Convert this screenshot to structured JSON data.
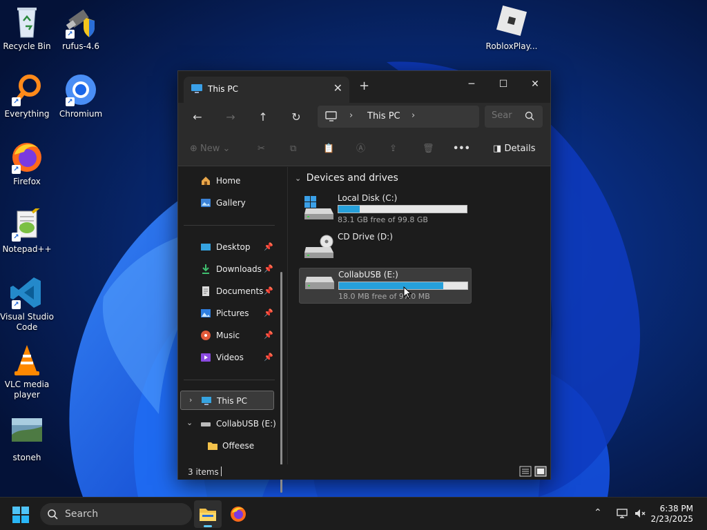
{
  "desktop": {
    "icons": [
      {
        "label": "Recycle Bin"
      },
      {
        "label": "rufus-4.6"
      },
      {
        "label": "Everything"
      },
      {
        "label": "Chromium"
      },
      {
        "label": "Firefox"
      },
      {
        "label": "Notepad++"
      },
      {
        "label": "Visual Studio Code"
      },
      {
        "label": "VLC media player"
      },
      {
        "label": "stoneh"
      },
      {
        "label": "RobloxPlay..."
      }
    ]
  },
  "explorer": {
    "tab_title": "This PC",
    "breadcrumb": "This PC",
    "search_placeholder": "Sear",
    "toolbar": {
      "new_label": "New",
      "details_label": "Details"
    },
    "sidebar": {
      "items": [
        {
          "label": "Home"
        },
        {
          "label": "Gallery"
        },
        {
          "label": "Desktop"
        },
        {
          "label": "Downloads"
        },
        {
          "label": "Documents"
        },
        {
          "label": "Pictures"
        },
        {
          "label": "Music"
        },
        {
          "label": "Videos"
        },
        {
          "label": "This PC"
        },
        {
          "label": "CollabUSB (E:)"
        },
        {
          "label": "Offeese"
        }
      ]
    },
    "section_title": "Devices and drives",
    "drives": [
      {
        "name": "Local Disk (C:)",
        "free_text": "83.1 GB free of 99.8 GB",
        "used_fraction": 0.167
      },
      {
        "name": "CD Drive (D:)"
      },
      {
        "name": "CollabUSB (E:)",
        "free_text": "18.0 MB free of 97.0 MB",
        "used_fraction": 0.814
      }
    ],
    "status": {
      "item_count": "3 items"
    }
  },
  "taskbar": {
    "search_placeholder": "Search",
    "time": "6:38 PM",
    "date": "2/23/2025"
  },
  "colors": {
    "accent": "#26a0da",
    "window_bg": "#1c1c1c",
    "toolbar_bg": "#2b2b2b"
  }
}
